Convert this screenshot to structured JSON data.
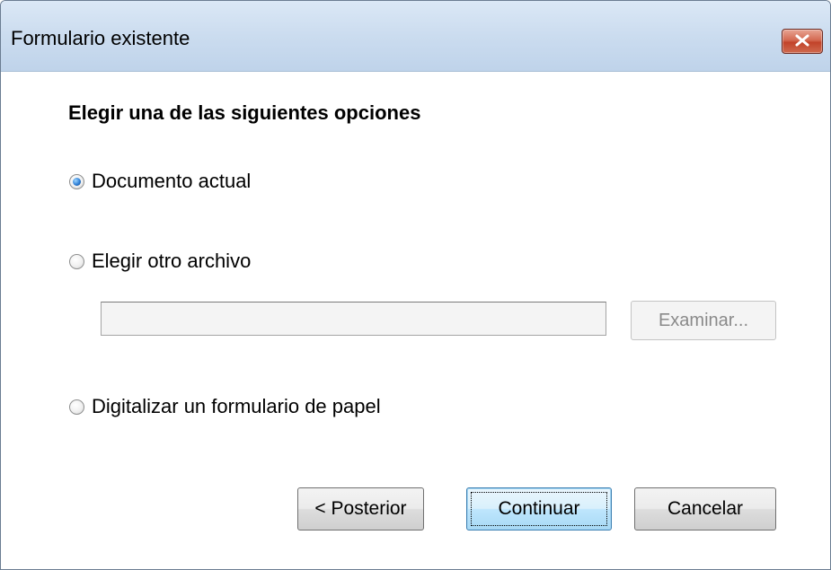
{
  "window": {
    "title": "Formulario existente",
    "close_icon": "close-icon"
  },
  "dialog": {
    "heading": "Elegir una de las siguientes opciones",
    "options": [
      {
        "label": "Documento actual",
        "selected": true
      },
      {
        "label": "Elegir otro archivo",
        "selected": false
      },
      {
        "label": "Digitalizar un formulario de papel",
        "selected": false
      }
    ],
    "file_input": {
      "value": ""
    },
    "browse_label": "Examinar..."
  },
  "buttons": {
    "back_label": "< Posterior",
    "continue_label": "Continuar",
    "cancel_label": "Cancelar"
  },
  "colors": {
    "titlebar": "#cbdcef",
    "close_button": "#c2432a",
    "radio_selected": "#2e7fd6"
  }
}
